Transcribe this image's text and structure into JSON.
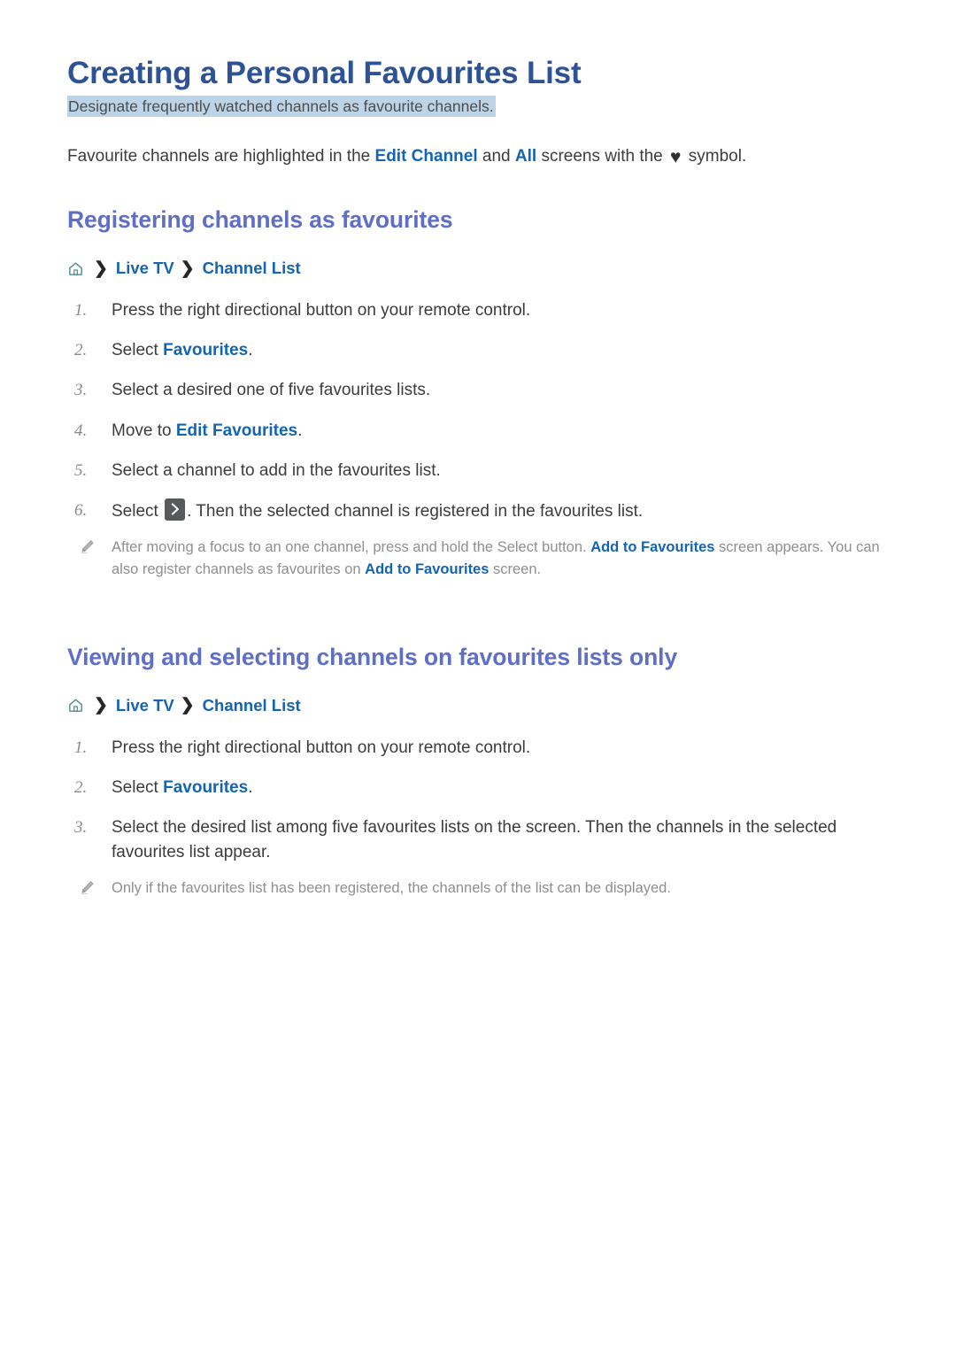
{
  "colors": {
    "title": "#2d5296",
    "section_heading": "#5f6ec6",
    "link": "#1464b4",
    "highlight": "#bcd4e6",
    "note_text": "#8f8f8f",
    "body_text": "#3c3c3c",
    "home_icon": "#4e8f8c",
    "select_key_bg": "#58595b"
  },
  "title": "Creating a Personal Favourites List",
  "subtitle": "Designate frequently watched channels as favourite channels.",
  "intro": {
    "part1": "Favourite channels are highlighted in the ",
    "link1": "Edit Channel",
    "part2": " and ",
    "link2": "All",
    "part3": " screens with the ",
    "heart": "♥",
    "part4": " symbol."
  },
  "sections": [
    {
      "heading": "Registering channels as favourites",
      "breadcrumb": {
        "home_icon": "home-icon",
        "separator": "❯",
        "items": [
          "Live TV",
          "Channel List"
        ]
      },
      "steps": [
        {
          "num": "1.",
          "parts": [
            {
              "type": "text",
              "value": "Press the right directional button on your remote control."
            }
          ]
        },
        {
          "num": "2.",
          "parts": [
            {
              "type": "text",
              "value": "Select "
            },
            {
              "type": "link",
              "value": "Favourites"
            },
            {
              "type": "text",
              "value": "."
            }
          ]
        },
        {
          "num": "3.",
          "parts": [
            {
              "type": "text",
              "value": "Select a desired one of five favourites lists."
            }
          ]
        },
        {
          "num": "4.",
          "parts": [
            {
              "type": "text",
              "value": "Move to "
            },
            {
              "type": "link",
              "value": "Edit Favourites"
            },
            {
              "type": "text",
              "value": "."
            }
          ]
        },
        {
          "num": "5.",
          "parts": [
            {
              "type": "text",
              "value": "Select a channel to add in the favourites list."
            }
          ]
        },
        {
          "num": "6.",
          "parts": [
            {
              "type": "text",
              "value": "Select "
            },
            {
              "type": "key",
              "value": "select-chevron-key"
            },
            {
              "type": "text",
              "value": ". Then the selected channel is registered in the favourites list."
            }
          ]
        }
      ],
      "note": {
        "icon": "pencil-icon",
        "line1_part1": "After moving a focus to an one channel, press and hold the Select button. ",
        "line1_link": "Add to Favourites",
        "line1_part2": " screen appears.",
        "line2_part1": "You can also register channels as favourites on ",
        "line2_link": "Add to Favourites",
        "line2_part2": " screen."
      }
    },
    {
      "heading": "Viewing and selecting channels on favourites lists only",
      "breadcrumb": {
        "home_icon": "home-icon",
        "separator": "❯",
        "items": [
          "Live TV",
          "Channel List"
        ]
      },
      "steps": [
        {
          "num": "1.",
          "parts": [
            {
              "type": "text",
              "value": "Press the right directional button on your remote control."
            }
          ]
        },
        {
          "num": "2.",
          "parts": [
            {
              "type": "text",
              "value": "Select "
            },
            {
              "type": "link",
              "value": "Favourites"
            },
            {
              "type": "text",
              "value": "."
            }
          ]
        },
        {
          "num": "3.",
          "parts": [
            {
              "type": "text",
              "value": "Select the desired list among five favourites lists on the screen. Then the channels in the selected favourites list appear."
            }
          ]
        }
      ],
      "note": {
        "icon": "pencil-icon",
        "line1_part1": "Only if the favourites list has been registered, the channels of the list can be displayed.",
        "line1_link": "",
        "line1_part2": "",
        "line2_part1": "",
        "line2_link": "",
        "line2_part2": ""
      }
    }
  ]
}
